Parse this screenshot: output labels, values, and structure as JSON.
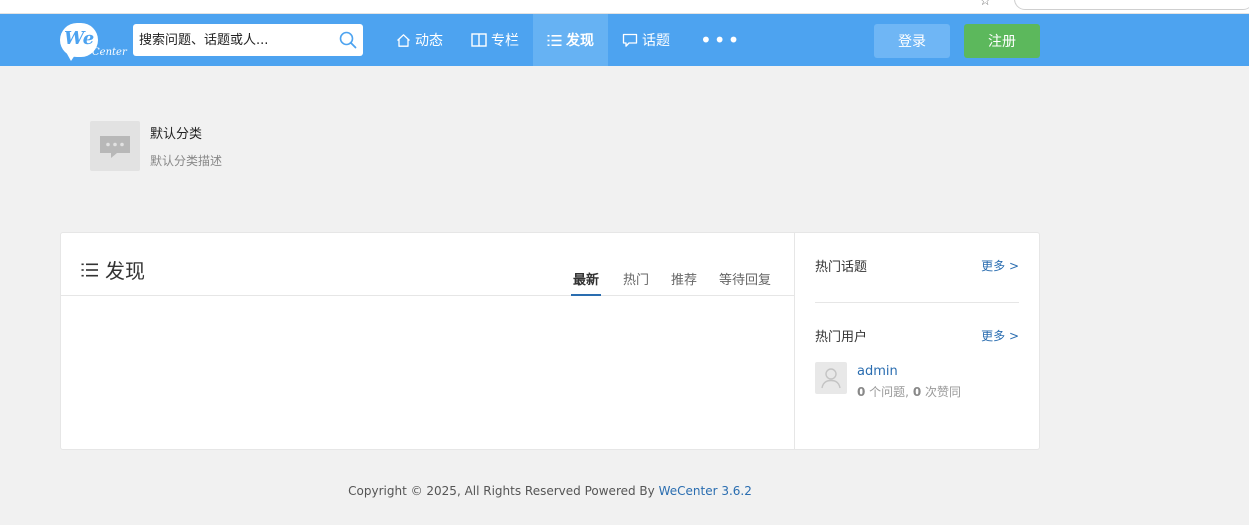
{
  "brand": {
    "logo_primary": "We",
    "logo_secondary": "Center",
    "color": "#4da3f0"
  },
  "search": {
    "placeholder": "搜索问题、话题或人..."
  },
  "nav": {
    "items": [
      {
        "label": "动态",
        "icon": "home-icon"
      },
      {
        "label": "专栏",
        "icon": "columns-icon"
      },
      {
        "label": "发现",
        "icon": "list-icon",
        "active": true
      },
      {
        "label": "话题",
        "icon": "comment-icon"
      }
    ],
    "more_label": "•••"
  },
  "auth": {
    "login_label": "登录",
    "register_label": "注册",
    "login_color": "#6fb6f5",
    "register_color": "#5cb85c"
  },
  "category": {
    "title": "默认分类",
    "description": "默认分类描述"
  },
  "discover": {
    "title": "发现",
    "tabs": [
      {
        "label": "最新",
        "active": true
      },
      {
        "label": "热门"
      },
      {
        "label": "推荐"
      },
      {
        "label": "等待回复"
      }
    ]
  },
  "sidebar": {
    "hot_topics": {
      "title": "热门话题",
      "more": "更多 >"
    },
    "hot_users": {
      "title": "热门用户",
      "more": "更多 >",
      "users": [
        {
          "name": "admin",
          "questions": "0",
          "questions_label": " 个问题, ",
          "likes": "0",
          "likes_label": " 次赞同"
        }
      ]
    }
  },
  "footer": {
    "text": "Copyright © 2025, All Rights Reserved Powered By ",
    "link": "WeCenter 3.6.2"
  }
}
